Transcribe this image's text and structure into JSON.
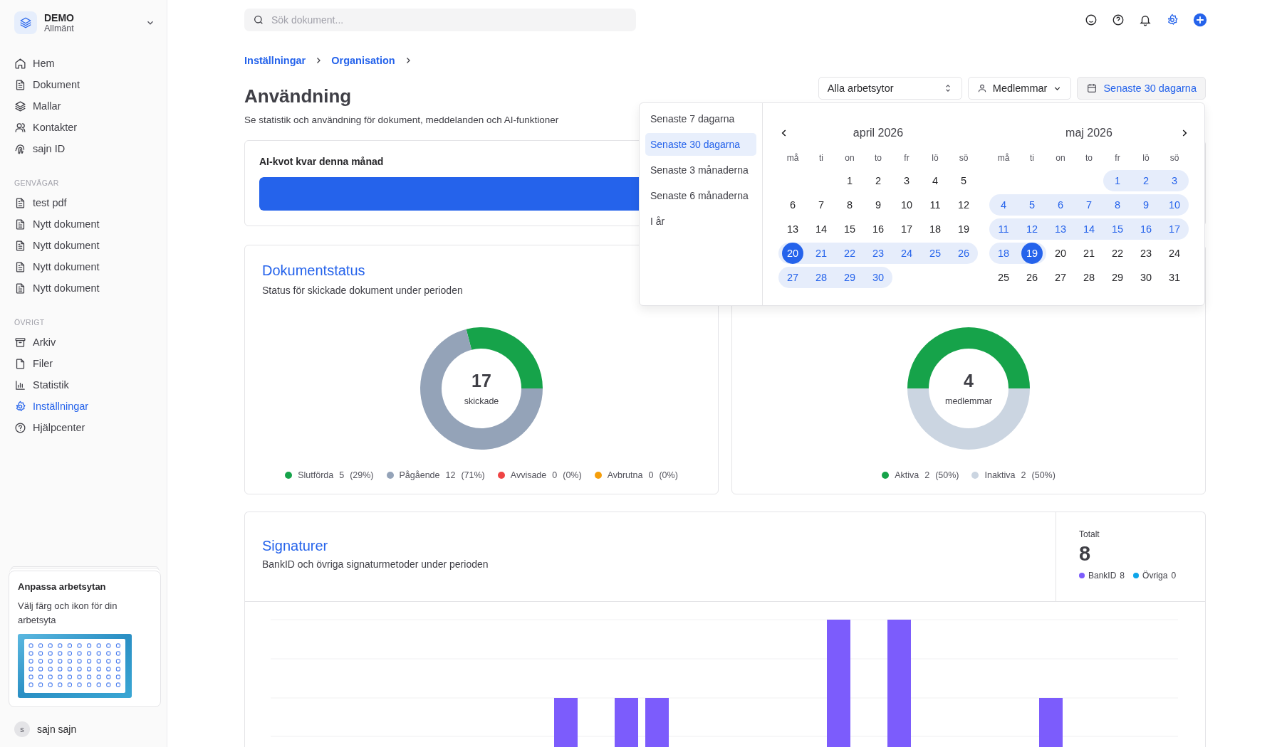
{
  "workspace": {
    "name": "DEMO",
    "subtitle": "Allmänt"
  },
  "sidebar": {
    "sections": [
      {
        "items": [
          {
            "label": "Hem",
            "kind": "home",
            "selected": false
          },
          {
            "label": "Dokument",
            "kind": "document",
            "selected": false
          },
          {
            "label": "Mallar",
            "kind": "layers",
            "selected": false
          },
          {
            "label": "Kontakter",
            "kind": "user",
            "selected": false
          },
          {
            "label": "sajn ID",
            "kind": "fingerprint",
            "selected": false
          }
        ]
      },
      {
        "heading": "GENVÄGAR",
        "items": [
          {
            "label": "test pdf",
            "kind": "document",
            "selected": false
          },
          {
            "label": "Nytt dokument",
            "kind": "document",
            "selected": false
          },
          {
            "label": "Nytt dokument",
            "kind": "document",
            "selected": false
          },
          {
            "label": "Nytt dokument",
            "kind": "document",
            "selected": false
          },
          {
            "label": "Nytt dokument",
            "kind": "document",
            "selected": false
          }
        ]
      },
      {
        "heading": "ÖVRIGT",
        "items": [
          {
            "label": "Arkiv",
            "kind": "archive",
            "selected": false
          },
          {
            "label": "Filer",
            "kind": "file",
            "selected": false
          },
          {
            "label": "Statistik",
            "kind": "chart",
            "selected": false
          },
          {
            "label": "Inställningar",
            "kind": "settings",
            "selected": true
          },
          {
            "label": "Hjälpcenter",
            "kind": "help",
            "selected": false
          }
        ]
      }
    ]
  },
  "promo": {
    "title": "Anpassa arbetsytan",
    "text": "Välj färg och ikon för din arbetsyta",
    "kind": "picture"
  },
  "user": {
    "initial": "s",
    "name": "sajn sajn"
  },
  "search": {
    "placeholder": "Sök dokument..."
  },
  "breadcrumb": [
    "Inställningar",
    "Organisation"
  ],
  "page": {
    "title": "Användning",
    "subtitle": "Se statistik och användning för dokument, meddelanden och AI-funktioner"
  },
  "filters": {
    "workspace": "Alla arbetsytor",
    "members": "Medlemmar",
    "period": "Senaste 30 dagarna"
  },
  "date_picker": {
    "presets": [
      {
        "label": "Senaste 7 dagarna",
        "selected": false
      },
      {
        "label": "Senaste 30 dagarna",
        "selected": true
      },
      {
        "label": "Senaste 3 månaderna",
        "selected": false
      },
      {
        "label": "Senaste 6 månaderna",
        "selected": false
      },
      {
        "label": "I år",
        "selected": false
      }
    ],
    "months": [
      {
        "title": "april 2026",
        "weekdays": [
          "må",
          "ti",
          "on",
          "to",
          "fr",
          "lö",
          "sö"
        ],
        "weeks": [
          {
            "kind": "end",
            "days": [
              {
                "day": "1",
                "in_range": false,
                "selected": false
              },
              {
                "day": "2",
                "in_range": false,
                "selected": false
              },
              {
                "day": "3",
                "in_range": false,
                "selected": false
              },
              {
                "day": "4",
                "in_range": false,
                "selected": false
              },
              {
                "day": "5",
                "in_range": false,
                "selected": false
              }
            ]
          },
          {
            "kind": "start",
            "days": [
              {
                "day": "6",
                "in_range": false,
                "selected": false
              },
              {
                "day": "7",
                "in_range": false,
                "selected": false
              },
              {
                "day": "8",
                "in_range": false,
                "selected": false
              },
              {
                "day": "9",
                "in_range": false,
                "selected": false
              },
              {
                "day": "10",
                "in_range": false,
                "selected": false
              },
              {
                "day": "11",
                "in_range": false,
                "selected": false
              },
              {
                "day": "12",
                "in_range": false,
                "selected": false
              }
            ]
          },
          {
            "kind": "start",
            "days": [
              {
                "day": "13",
                "in_range": false,
                "selected": false
              },
              {
                "day": "14",
                "in_range": false,
                "selected": false
              },
              {
                "day": "15",
                "in_range": false,
                "selected": false
              },
              {
                "day": "16",
                "in_range": false,
                "selected": false
              },
              {
                "day": "17",
                "in_range": false,
                "selected": false
              },
              {
                "day": "18",
                "in_range": false,
                "selected": false
              },
              {
                "day": "19",
                "in_range": false,
                "selected": false
              }
            ]
          },
          {
            "kind": "start",
            "days": [
              {
                "day": "20",
                "in_range": true,
                "selected": true
              },
              {
                "day": "21",
                "in_range": true,
                "selected": false
              },
              {
                "day": "22",
                "in_range": true,
                "selected": false
              },
              {
                "day": "23",
                "in_range": true,
                "selected": false
              },
              {
                "day": "24",
                "in_range": true,
                "selected": false
              },
              {
                "day": "25",
                "in_range": true,
                "selected": false
              },
              {
                "day": "26",
                "in_range": true,
                "selected": false
              }
            ]
          },
          {
            "kind": "start",
            "days": [
              {
                "day": "27",
                "in_range": true,
                "selected": false
              },
              {
                "day": "28",
                "in_range": true,
                "selected": false
              },
              {
                "day": "29",
                "in_range": true,
                "selected": false
              },
              {
                "day": "30",
                "in_range": true,
                "selected": false
              }
            ]
          }
        ]
      },
      {
        "title": "maj 2026",
        "weekdays": [
          "må",
          "ti",
          "on",
          "to",
          "fr",
          "lö",
          "sö"
        ],
        "weeks": [
          {
            "kind": "end",
            "days": [
              {
                "day": "1",
                "in_range": true,
                "selected": false
              },
              {
                "day": "2",
                "in_range": true,
                "selected": false
              },
              {
                "day": "3",
                "in_range": true,
                "selected": false
              }
            ]
          },
          {
            "kind": "start",
            "days": [
              {
                "day": "4",
                "in_range": true,
                "selected": false
              },
              {
                "day": "5",
                "in_range": true,
                "selected": false
              },
              {
                "day": "6",
                "in_range": true,
                "selected": false
              },
              {
                "day": "7",
                "in_range": true,
                "selected": false
              },
              {
                "day": "8",
                "in_range": true,
                "selected": false
              },
              {
                "day": "9",
                "in_range": true,
                "selected": false
              },
              {
                "day": "10",
                "in_range": true,
                "selected": false
              }
            ]
          },
          {
            "kind": "start",
            "days": [
              {
                "day": "11",
                "in_range": true,
                "selected": false
              },
              {
                "day": "12",
                "in_range": true,
                "selected": false
              },
              {
                "day": "13",
                "in_range": true,
                "selected": false
              },
              {
                "day": "14",
                "in_range": true,
                "selected": false
              },
              {
                "day": "15",
                "in_range": true,
                "selected": false
              },
              {
                "day": "16",
                "in_range": true,
                "selected": false
              },
              {
                "day": "17",
                "in_range": true,
                "selected": false
              }
            ]
          },
          {
            "kind": "start",
            "days": [
              {
                "day": "18",
                "in_range": true,
                "selected": false
              },
              {
                "day": "19",
                "in_range": true,
                "selected": true
              },
              {
                "day": "20",
                "in_range": false,
                "selected": false
              },
              {
                "day": "21",
                "in_range": false,
                "selected": false
              },
              {
                "day": "22",
                "in_range": false,
                "selected": false
              },
              {
                "day": "23",
                "in_range": false,
                "selected": false
              },
              {
                "day": "24",
                "in_range": false,
                "selected": false
              }
            ]
          },
          {
            "kind": "start",
            "days": [
              {
                "day": "25",
                "in_range": false,
                "selected": false
              },
              {
                "day": "26",
                "in_range": false,
                "selected": false
              },
              {
                "day": "27",
                "in_range": false,
                "selected": false
              },
              {
                "day": "28",
                "in_range": false,
                "selected": false
              },
              {
                "day": "29",
                "in_range": false,
                "selected": false
              },
              {
                "day": "30",
                "in_range": false,
                "selected": false
              },
              {
                "day": "31",
                "in_range": false,
                "selected": false
              }
            ]
          }
        ]
      }
    ]
  },
  "quota": {
    "title": "AI-kvot kvar denna månad",
    "level": 1
  },
  "document_status": {
    "title": "Dokumentstatus",
    "subtitle": "Status för skickade dokument under perioden",
    "total": "17",
    "total_label": "skickade",
    "legend": [
      {
        "count": "5",
        "percent": "(29%)",
        "color": "#16a34a"
      },
      {
        "count": "12",
        "percent": "(71%)",
        "color": "#94a3b8"
      },
      {
        "count": "0",
        "percent": "(0%)",
        "color": "#ef4444"
      },
      {
        "count": "0",
        "percent": "(0%)",
        "color": "#f59e0b"
      }
    ],
    "chart_data": {
      "type": "donut",
      "categories": [
        "Slutförda",
        "Pågående",
        "Avvisade",
        "Avbrutna"
      ],
      "values": [
        29,
        71,
        0,
        0
      ]
    }
  },
  "members": {
    "total": "4",
    "total_label": "medlemmar",
    "legend": [
      {
        "count": "2",
        "percent": "(50%)",
        "color": "#16a34a"
      },
      {
        "count": "2",
        "percent": "(50%)",
        "color": "#cbd5e1"
      }
    ],
    "chart_data": {
      "type": "donut",
      "categories": [
        "Aktiva",
        "Inaktiva"
      ],
      "values": [
        50,
        50
      ]
    }
  },
  "signatures": {
    "title": "Signaturer",
    "subtitle": "BankID och övriga signaturmetoder under perioden",
    "total_label": "Totalt",
    "total": "8",
    "legend": [
      {
        "label": "BankID",
        "count": "8",
        "color": "#7c5cfc"
      },
      {
        "label": "Övriga",
        "count": "0",
        "color": "#0ea5e9"
      }
    ]
  }
}
